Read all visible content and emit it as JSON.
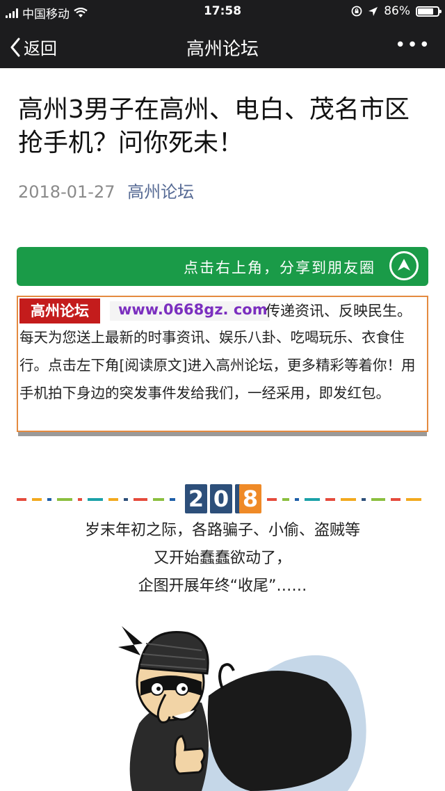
{
  "status_bar": {
    "carrier": "中国移动",
    "time": "17:58",
    "battery": "86%",
    "battery_level": 0.86
  },
  "nav": {
    "back_label": "返回",
    "title": "高州论坛",
    "more_label": "•••"
  },
  "article": {
    "title": "高州3男子在高州、电白、茂名市区抢手机？问你死未！",
    "date": "2018-01-27",
    "source": "高州论坛"
  },
  "share_banner": {
    "label": "点击右上角，分享到朋友圈"
  },
  "intro": {
    "badge": "高州论坛",
    "website": "www.0668gz. com",
    "line1": "传递资讯、反映民生。",
    "body": "每天为您送上最新的时事资讯、娱乐八卦、吃喝玩乐、衣食住行。点击左下角[阅读原文]进入高州论坛，更多精彩等着你！用手机拍下身边的突发事件发给我们，一经采用，即发红包。"
  },
  "year_banner": {
    "digits": [
      "2",
      "0",
      "1",
      "8"
    ]
  },
  "poem": {
    "line1": "岁末年初之际，各路骗子、小偷、盗贼等",
    "line2": "又开始蠢蠢欲动了，",
    "line3": "企图开展年终“收尾”……"
  },
  "colors": {
    "nav_bg": "#1c1c1e",
    "share_green": "#1a9b48",
    "badge_red": "#c41c1c",
    "link_blue": "#576b95",
    "orange_border": "#e48a3f"
  }
}
